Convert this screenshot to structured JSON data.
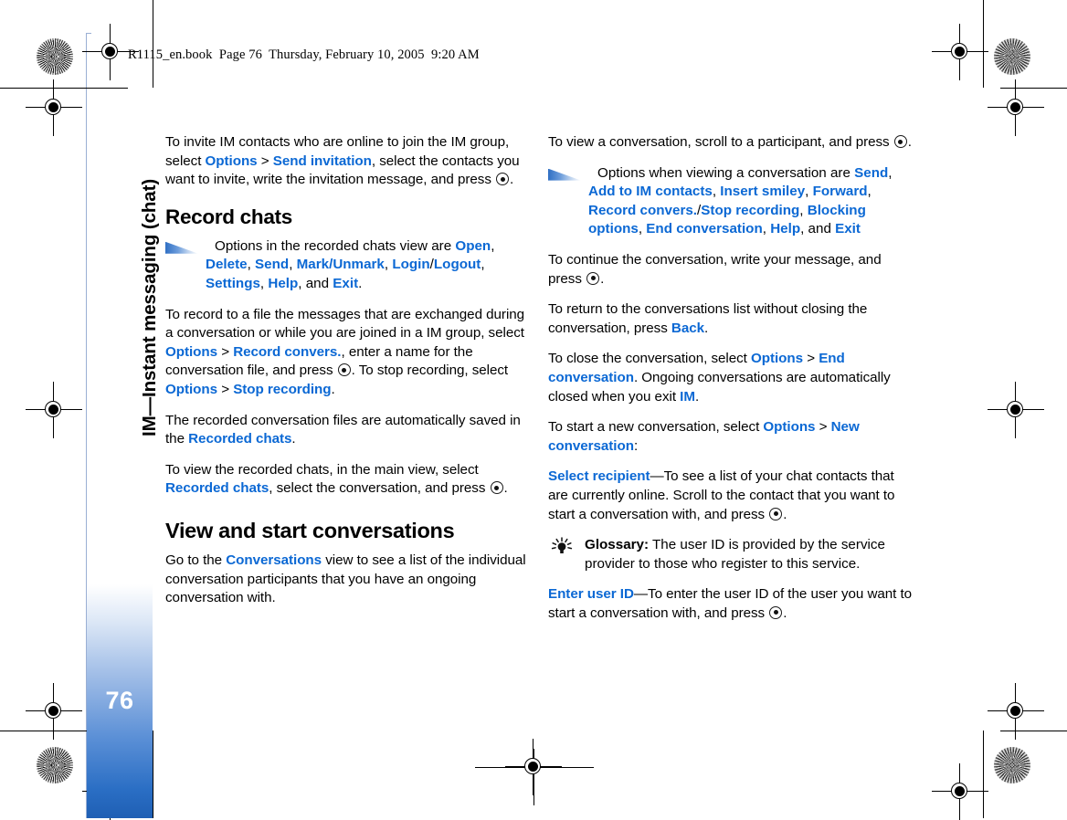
{
  "header": {
    "running_head": "R1115_en.book  Page 76  Thursday, February 10, 2005  9:20 AM"
  },
  "sidebar": {
    "chapter_title": "IM—Instant messaging (chat)",
    "page_number": "76",
    "tab_color": "#2a6ec4"
  },
  "accent_color": "#0b68d4",
  "icons": {
    "note_arrow": "note-arrow-icon",
    "glossary_bulb": "lightbulb-icon",
    "scroll_key": "scroll-key-icon"
  },
  "left_column": {
    "para_invite": {
      "t1": "To invite IM contacts who are online to join the IM group, select ",
      "k1": "Options",
      "t2": " > ",
      "k2": "Send invitation",
      "t3": ", select the contacts you want to invite, write the invitation message, and press ",
      "t4": "."
    },
    "heading_record_chats": "Record chats",
    "note_recorded_view": {
      "t1": "Options in the recorded chats view are ",
      "k1": "Open",
      "t2": ", ",
      "k2": "Delete",
      "t3": ", ",
      "k3": "Send",
      "t4": ", ",
      "k4": "Mark/Unmark",
      "t5": ", ",
      "k5": "Login",
      "t6": "/",
      "k6": "Logout",
      "t7": ", ",
      "k7": "Settings",
      "t8": ", ",
      "k8": "Help",
      "t9": ", and ",
      "k9": "Exit",
      "t10": "."
    },
    "para_record_file": {
      "t1": "To record to a file the messages that are exchanged during a conversation or while you are joined in a IM group, select ",
      "k1": "Options",
      "t2": " > ",
      "k2": "Record convers.",
      "t3": ", enter a name for the conversation file, and press ",
      "t4": ". To stop recording, select ",
      "k3": "Options",
      "t5": " > ",
      "k4": "Stop recording",
      "t6": "."
    },
    "para_saved_in": {
      "t1": "The recorded conversation files are automatically saved in the ",
      "k1": "Recorded chats",
      "t2": "."
    },
    "para_view_recorded": {
      "t1": "To view the recorded chats, in the main view, select ",
      "k1": "Recorded chats",
      "t2": ", select the conversation, and press ",
      "t3": "."
    },
    "heading_view_start": "View and start conversations",
    "para_go_to": {
      "t1": "Go to the ",
      "k1": "Conversations",
      "t2": " view to see a list of the individual conversation participants that you have an ongoing conversation with."
    }
  },
  "right_column": {
    "para_view_conv": {
      "t1": "To view a conversation, scroll to a participant, and press ",
      "t2": "."
    },
    "note_viewing_options": {
      "t1": "Options when viewing a conversation are ",
      "k1": "Send",
      "t2": ", ",
      "k2": "Add to IM contacts",
      "t3": ", ",
      "k3": "Insert smiley",
      "t4": ", ",
      "k4": "Forward",
      "t5": ", ",
      "k5": "Record convers.",
      "t6": "/",
      "k6": "Stop recording",
      "t7": ", ",
      "k7": "Blocking options",
      "t8": ", ",
      "k8": "End conversation",
      "t9": ", ",
      "k9": "Help",
      "t10": ", and ",
      "k10": "Exit"
    },
    "para_continue": {
      "t1": "To continue the conversation, write your message, and press ",
      "t2": "."
    },
    "para_return": {
      "t1": "To return to the conversations list without closing the conversation, press ",
      "k1": "Back",
      "t2": "."
    },
    "para_close": {
      "t1": "To close the conversation, select ",
      "k1": "Options",
      "t2": " > ",
      "k2": "End conversation",
      "t3": ". Ongoing conversations are automatically closed when you exit ",
      "k3": "IM",
      "t4": "."
    },
    "para_start_new": {
      "t1": "To start a new conversation, select ",
      "k1": "Options",
      "t2": " > ",
      "k2": "New conversation",
      "t3": ":"
    },
    "para_select_recipient": {
      "k1": "Select recipient",
      "t1": "—To see a list of your chat contacts that are currently online. Scroll to the contact that you want to start a conversation with, and press ",
      "t2": "."
    },
    "tip_glossary": {
      "label": "Glossary:",
      "text": " The user ID is provided by the service provider to those who register to this service."
    },
    "para_enter_user_id": {
      "k1": "Enter user ID",
      "t1": "—To enter the user ID of the user you want to start a conversation with, and press ",
      "t2": "."
    }
  }
}
